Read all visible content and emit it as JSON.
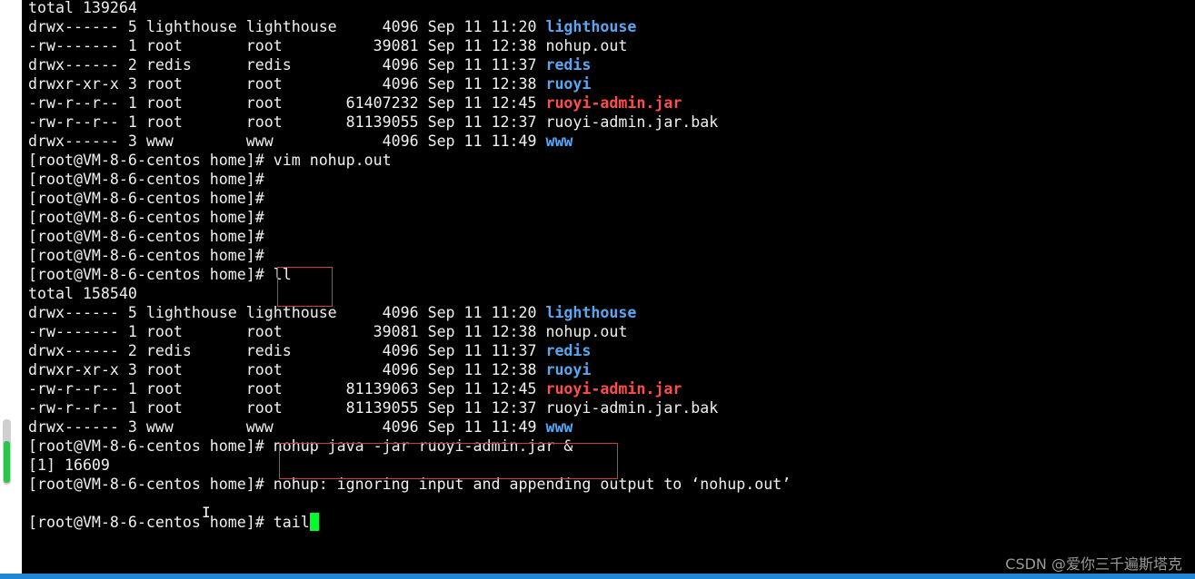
{
  "terminal": {
    "lines": [
      {
        "segments": [
          {
            "text": "total 139264",
            "style": "normal"
          }
        ]
      },
      {
        "segments": [
          {
            "text": "drwx------ 5 lighthouse lighthouse     4096 Sep 11 11:20 ",
            "style": "normal"
          },
          {
            "text": "lighthouse",
            "style": "dir"
          }
        ]
      },
      {
        "segments": [
          {
            "text": "-rw------- 1 root       root          39081 Sep 11 12:38 nohup.out",
            "style": "normal"
          }
        ]
      },
      {
        "segments": [
          {
            "text": "drwx------ 2 redis      redis          4096 Sep 11 11:37 ",
            "style": "normal"
          },
          {
            "text": "redis",
            "style": "dir"
          }
        ]
      },
      {
        "segments": [
          {
            "text": "drwxr-xr-x 3 root       root           4096 Sep 11 12:38 ",
            "style": "normal"
          },
          {
            "text": "ruoyi",
            "style": "dir"
          }
        ]
      },
      {
        "segments": [
          {
            "text": "-rw-r--r-- 1 root       root       61407232 Sep 11 12:45 ",
            "style": "normal"
          },
          {
            "text": "ruoyi-admin.jar",
            "style": "arch"
          }
        ]
      },
      {
        "segments": [
          {
            "text": "-rw-r--r-- 1 root       root       81139055 Sep 11 12:37 ruoyi-admin.jar.bak",
            "style": "normal"
          }
        ]
      },
      {
        "segments": [
          {
            "text": "drwx------ 3 www        www            4096 Sep 11 11:49 ",
            "style": "normal"
          },
          {
            "text": "www",
            "style": "dir"
          }
        ]
      },
      {
        "segments": [
          {
            "text": "[root@VM-8-6-centos home]# vim nohup.out",
            "style": "normal"
          }
        ]
      },
      {
        "segments": [
          {
            "text": "[root@VM-8-6-centos home]#",
            "style": "normal"
          }
        ]
      },
      {
        "segments": [
          {
            "text": "[root@VM-8-6-centos home]#",
            "style": "normal"
          }
        ]
      },
      {
        "segments": [
          {
            "text": "[root@VM-8-6-centos home]#",
            "style": "normal"
          }
        ]
      },
      {
        "segments": [
          {
            "text": "[root@VM-8-6-centos home]#",
            "style": "normal"
          }
        ]
      },
      {
        "segments": [
          {
            "text": "[root@VM-8-6-centos home]#",
            "style": "normal"
          }
        ]
      },
      {
        "segments": [
          {
            "text": "[root@VM-8-6-centos home]# ll",
            "style": "normal"
          }
        ]
      },
      {
        "segments": [
          {
            "text": "total 158540",
            "style": "normal"
          }
        ]
      },
      {
        "segments": [
          {
            "text": "drwx------ 5 lighthouse lighthouse     4096 Sep 11 11:20 ",
            "style": "normal"
          },
          {
            "text": "lighthouse",
            "style": "dir"
          }
        ]
      },
      {
        "segments": [
          {
            "text": "-rw------- 1 root       root          39081 Sep 11 12:38 nohup.out",
            "style": "normal"
          }
        ]
      },
      {
        "segments": [
          {
            "text": "drwx------ 2 redis      redis          4096 Sep 11 11:37 ",
            "style": "normal"
          },
          {
            "text": "redis",
            "style": "dir"
          }
        ]
      },
      {
        "segments": [
          {
            "text": "drwxr-xr-x 3 root       root           4096 Sep 11 12:38 ",
            "style": "normal"
          },
          {
            "text": "ruoyi",
            "style": "dir"
          }
        ]
      },
      {
        "segments": [
          {
            "text": "-rw-r--r-- 1 root       root       81139063 Sep 11 12:45 ",
            "style": "normal"
          },
          {
            "text": "ruoyi-admin.jar",
            "style": "arch"
          }
        ]
      },
      {
        "segments": [
          {
            "text": "-rw-r--r-- 1 root       root       81139055 Sep 11 12:37 ruoyi-admin.jar.bak",
            "style": "normal"
          }
        ]
      },
      {
        "segments": [
          {
            "text": "drwx------ 3 www        www            4096 Sep 11 11:49 ",
            "style": "normal"
          },
          {
            "text": "www",
            "style": "dir"
          }
        ]
      },
      {
        "segments": [
          {
            "text": "[root@VM-8-6-centos home]# nohup java -jar ruoyi-admin.jar &",
            "style": "normal"
          }
        ]
      },
      {
        "segments": [
          {
            "text": "[1] 16609",
            "style": "normal"
          }
        ]
      },
      {
        "segments": [
          {
            "text": "[root@VM-8-6-centos home]# nohup: ignoring input and appending output to ‘nohup.out’",
            "style": "normal"
          }
        ]
      },
      {
        "segments": [
          {
            "text": "",
            "style": "normal"
          }
        ]
      },
      {
        "segments": [
          {
            "text": "[root@VM-8-6-centos home]# tail",
            "style": "normal"
          }
        ],
        "cursor": true
      }
    ]
  },
  "watermark": "CSDN @爱你三千遍斯塔克",
  "colors": {
    "background": "#000000",
    "text": "#f0f0f0",
    "directory": "#5aa6f0",
    "archive": "#ff4d4d",
    "cursor": "#00ff2a",
    "highlight_box": "#d43a3a",
    "bottom_bar": "#1e88d6"
  },
  "icons": {
    "mouse_pointer": "ibeam-cursor-icon"
  }
}
